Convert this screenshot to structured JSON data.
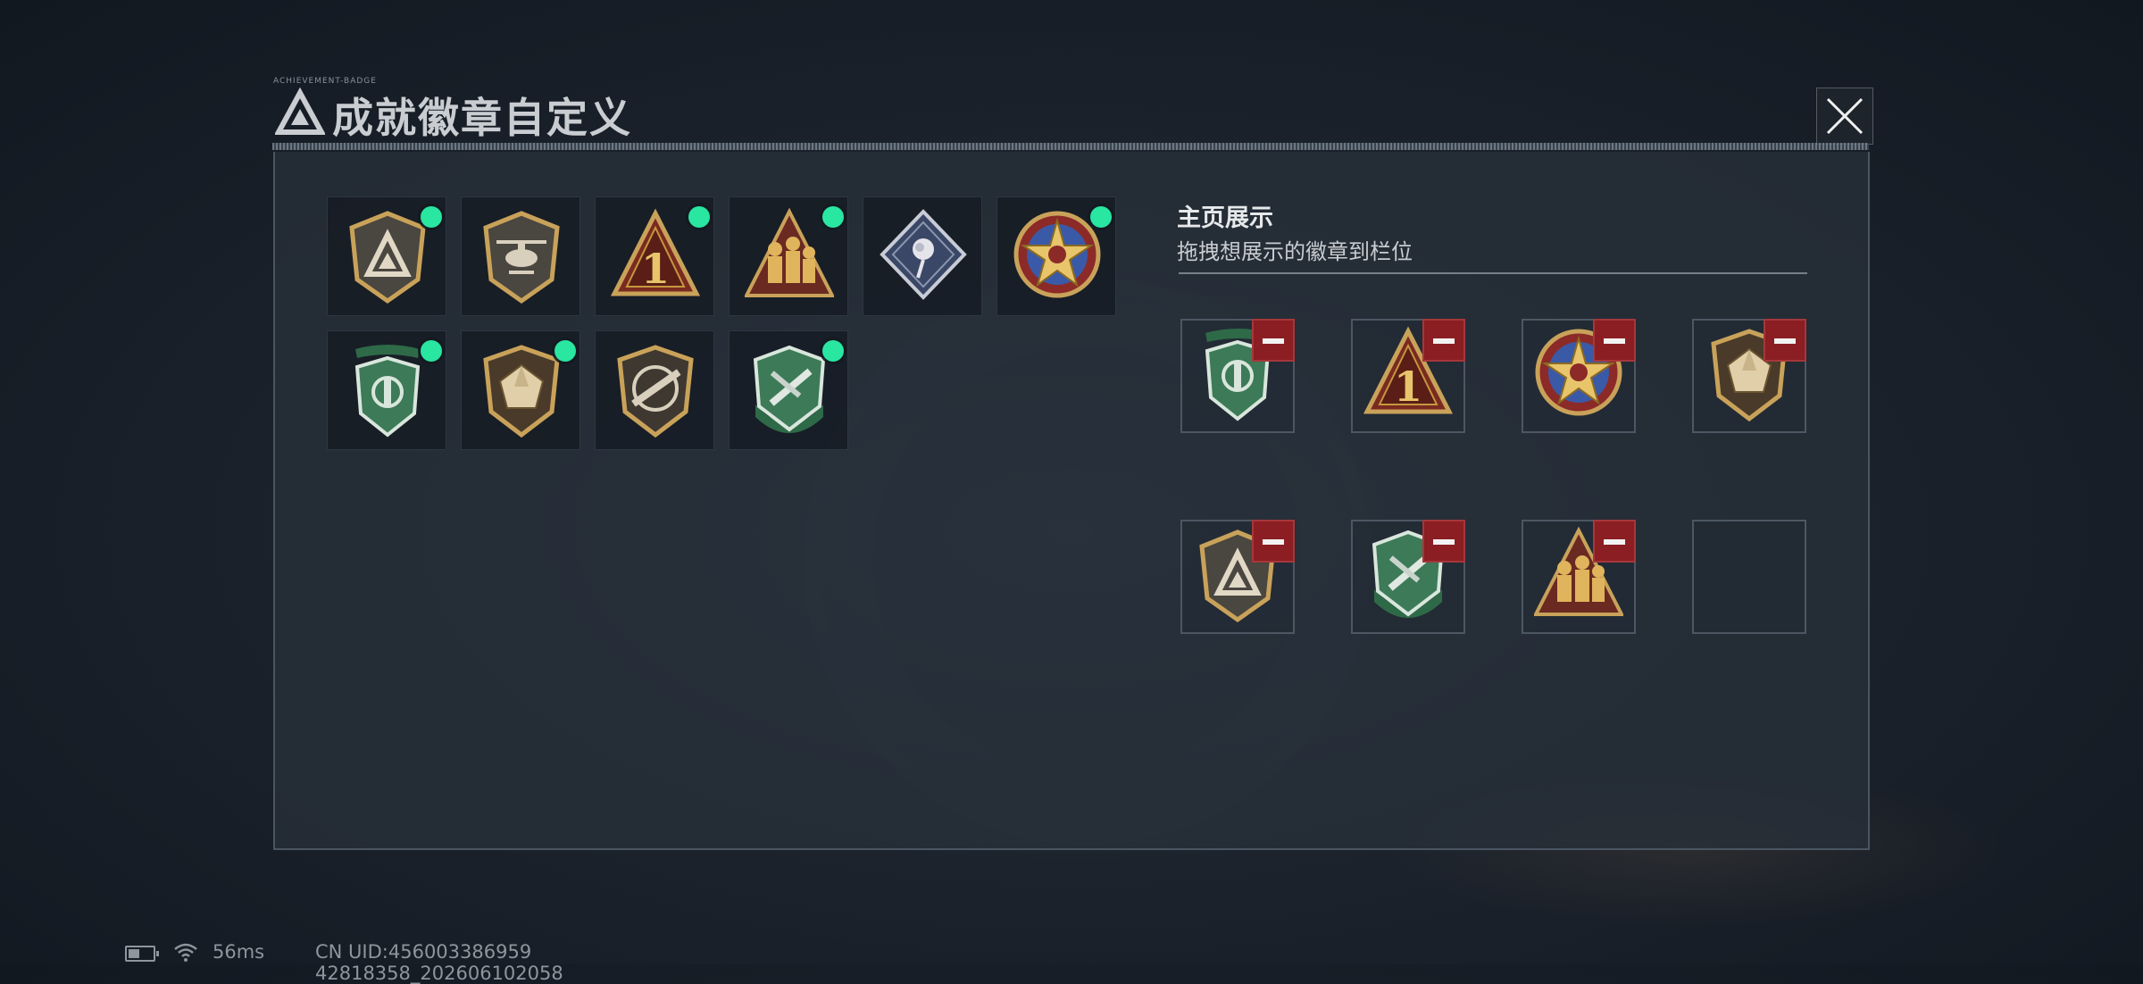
{
  "window": {
    "title": "成就徽章自定义",
    "title_tiny": "ACHIEVEMENT-BADGE"
  },
  "badges": [
    {
      "icon": "triangle-shield-badge-icon",
      "unlocked": true
    },
    {
      "icon": "helicopter-shield-badge-icon",
      "unlocked": false
    },
    {
      "icon": "number-one-triangle-badge-icon",
      "unlocked": true
    },
    {
      "icon": "soldiers-triangle-badge-icon",
      "unlocked": true
    },
    {
      "icon": "rose-diamond-badge-icon",
      "unlocked": false
    },
    {
      "icon": "star-medal-badge-icon",
      "unlocked": true
    },
    {
      "icon": "green-crest-badge-icon",
      "unlocked": true
    },
    {
      "icon": "gem-shield-badge-icon",
      "unlocked": true
    },
    {
      "icon": "rifle-shield-badge-icon",
      "unlocked": false
    },
    {
      "icon": "knife-shield-badge-icon",
      "unlocked": true
    }
  ],
  "showcase": {
    "title": "主页展示",
    "subtitle": "拖拽想展示的徽章到栏位",
    "slots": [
      {
        "icon": "green-crest-badge-icon",
        "filled": true
      },
      {
        "icon": "number-one-triangle-badge-icon",
        "filled": true
      },
      {
        "icon": "star-medal-badge-icon",
        "filled": true
      },
      {
        "icon": "gem-shield-badge-icon",
        "filled": true
      },
      {
        "icon": "triangle-shield-badge-icon",
        "filled": true
      },
      {
        "icon": "knife-shield-badge-icon",
        "filled": true
      },
      {
        "icon": "soldiers-triangle-badge-icon",
        "filled": true
      },
      {
        "icon": "",
        "filled": false
      }
    ]
  },
  "status": {
    "ping": "56ms",
    "uid": "CN UID:456003386959 42818358_202606102058"
  },
  "colors": {
    "unlocked_dot": "#29e6a1",
    "remove_button": "#8b1e22",
    "gold": "#c9a25a",
    "green_badge": "#3d7a58"
  }
}
